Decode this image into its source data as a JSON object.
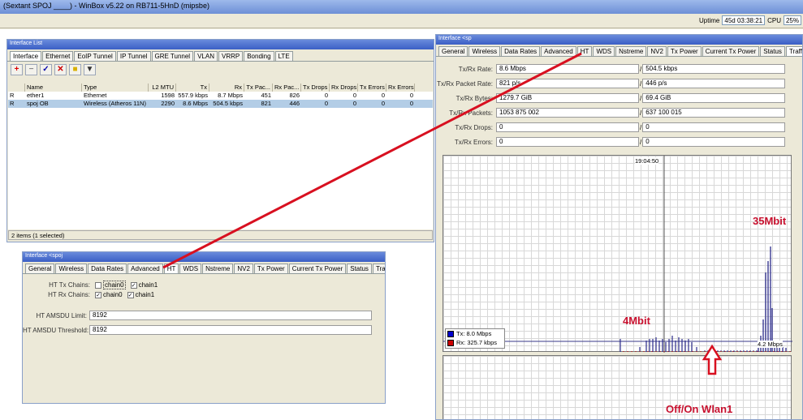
{
  "window": {
    "title": "(Sextant SPOJ ____) - WinBox v5.22 on RB711-5HnD (mipsbe)"
  },
  "status": {
    "uptime_label": "Uptime",
    "uptime_value": "45d 03:38:21",
    "cpu_label": "CPU",
    "cpu_value": "25%"
  },
  "iflist": {
    "title": "Interface List",
    "tabs": [
      "Interface",
      "Ethernet",
      "EoIP Tunnel",
      "IP Tunnel",
      "GRE Tunnel",
      "VLAN",
      "VRRP",
      "Bonding",
      "LTE"
    ],
    "columns": [
      "",
      "Name",
      "Type",
      "L2 MTU",
      "Tx",
      "Rx",
      "Tx Pac...",
      "Rx Pac...",
      "Tx Drops",
      "Rx Drops",
      "Tx Errors",
      "Rx Errors"
    ],
    "rows": [
      [
        "R",
        "ether1",
        "Ethernet",
        "1598",
        "557.9 kbps",
        "8.7 Mbps",
        "451",
        "826",
        "0",
        "0",
        "0",
        "0"
      ],
      [
        "R",
        "spoj OB",
        "Wireless (Atheros 11N)",
        "2290",
        "8.6 Mbps",
        "504.5 kbps",
        "821",
        "446",
        "0",
        "0",
        "0",
        "0"
      ]
    ],
    "footer": "2 items (1 selected)"
  },
  "ht": {
    "title": "Interface <spoj",
    "tabs": [
      "General",
      "Wireless",
      "Data Rates",
      "Advanced",
      "HT",
      "WDS",
      "Nstreme",
      "NV2",
      "Tx Power",
      "Current Tx Power",
      "Status",
      "Traffic"
    ],
    "tx_label": "HT Tx Chains:",
    "rx_label": "HT Rx Chains:",
    "chain0": "chain0",
    "chain1": "chain1",
    "amsdu_limit_label": "HT AMSDU Limit:",
    "amsdu_limit": "8192",
    "amsdu_threshold_label": "HT AMSDU Threshold:",
    "amsdu_threshold": "8192"
  },
  "traffic": {
    "title": "Interface <sp",
    "tabs": [
      "General",
      "Wireless",
      "Data Rates",
      "Advanced",
      "HT",
      "WDS",
      "Nstreme",
      "NV2",
      "Tx Power",
      "Current Tx Power",
      "Status",
      "Traffic"
    ],
    "rate_label": "Tx/Rx Rate:",
    "rate_tx": "8.6 Mbps",
    "rate_rx": "504.5 kbps",
    "pkt_rate_label": "Tx/Rx Packet Rate:",
    "pkt_rate_tx": "821 p/s",
    "pkt_rate_rx": "446 p/s",
    "bytes_label": "Tx/Rx Bytes:",
    "bytes_tx": "1279.7 GiB",
    "bytes_rx": "69.4 GiB",
    "packets_label": "Tx/Rx Packets:",
    "packets_tx": "1053 875 002",
    "packets_rx": "637 100 015",
    "drops_label": "Tx/Rx Drops:",
    "drops_tx": "0",
    "drops_rx": "0",
    "errors_label": "Tx/Rx Errors:",
    "errors_tx": "0",
    "errors_rx": "0",
    "time": "19:04:50",
    "legend_tx": "Tx:  8.0 Mbps",
    "legend_rx": "Rx:  325.7 kbps",
    "peak_label": "4.2 Mbps",
    "tx_color": "#0000cc",
    "rx_color": "#cc0000"
  },
  "annotations": {
    "a1": "35Mbit",
    "a2": "4Mbit",
    "a3": "Off/On Wlan1",
    "color": "#c8102e"
  }
}
